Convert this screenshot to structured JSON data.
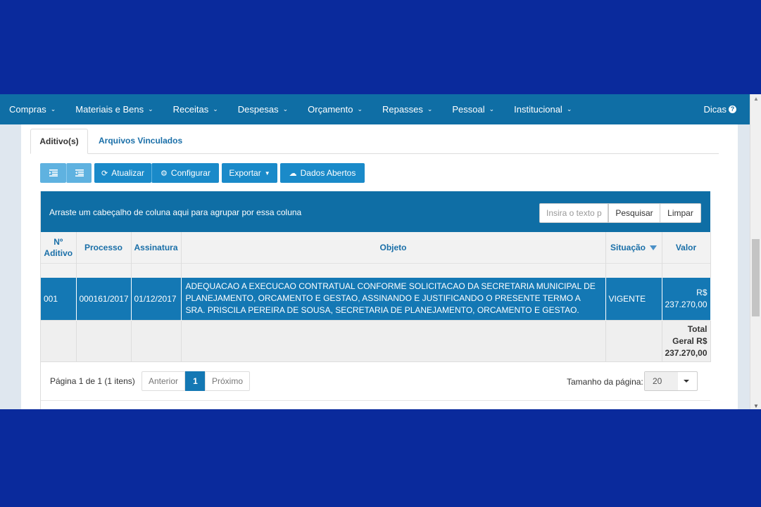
{
  "nav": {
    "items": [
      {
        "label": "Compras"
      },
      {
        "label": "Materiais e Bens"
      },
      {
        "label": "Receitas"
      },
      {
        "label": "Despesas"
      },
      {
        "label": "Orçamento"
      },
      {
        "label": "Repasses"
      },
      {
        "label": "Pessoal"
      },
      {
        "label": "Institucional"
      }
    ],
    "help_label": "Dicas"
  },
  "tabs": {
    "active": "Aditivo(s)",
    "second": "Arquivos Vinculados"
  },
  "toolbar": {
    "refresh_label": "Atualizar",
    "configure_label": "Configurar",
    "export_label": "Exportar",
    "open_data_label": "Dados Abertos"
  },
  "grid": {
    "group_hint": "Arraste um cabeçalho de coluna aqui para agrupar por essa coluna",
    "search_placeholder": "Insira o texto p",
    "search_button": "Pesquisar",
    "clear_button": "Limpar",
    "columns": {
      "numero_line1": "Nº",
      "numero_line2": "Aditivo",
      "processo": "Processo",
      "assinatura": "Assinatura",
      "objeto": "Objeto",
      "situacao": "Situação",
      "valor": "Valor"
    },
    "rows": [
      {
        "numero": "001",
        "processo": "000161/2017",
        "assinatura": "01/12/2017",
        "objeto": "ADEQUACAO A EXECUCAO CONTRATUAL CONFORME SOLICITACAO DA SECRETARIA MUNICIPAL DE PLANEJAMENTO, ORCAMENTO E GESTAO, ASSINANDO E JUSTIFICANDO O PRESENTE TERMO A SRA. PRISCILA PEREIRA DE SOUSA, SECRETARIA DE PLANEJAMENTO, ORCAMENTO E GESTAO.",
        "situacao": "VIGENTE",
        "valor_line1": "R$",
        "valor_line2": "237.270,00"
      }
    ],
    "total": {
      "line1": "Total",
      "line2": "Geral R$",
      "line3": "237.270,00"
    }
  },
  "pager": {
    "info": "Página 1 de 1 (1 itens)",
    "prev_label": "Anterior",
    "current_page": "1",
    "next_label": "Próximo",
    "page_size_label": "Tamanho da página:",
    "page_size_value": "20"
  },
  "colors": {
    "navbar": "#0f6ea5",
    "button": "#1a8ac9",
    "selected_row": "#1478b4",
    "background": "#0a2a9c"
  }
}
